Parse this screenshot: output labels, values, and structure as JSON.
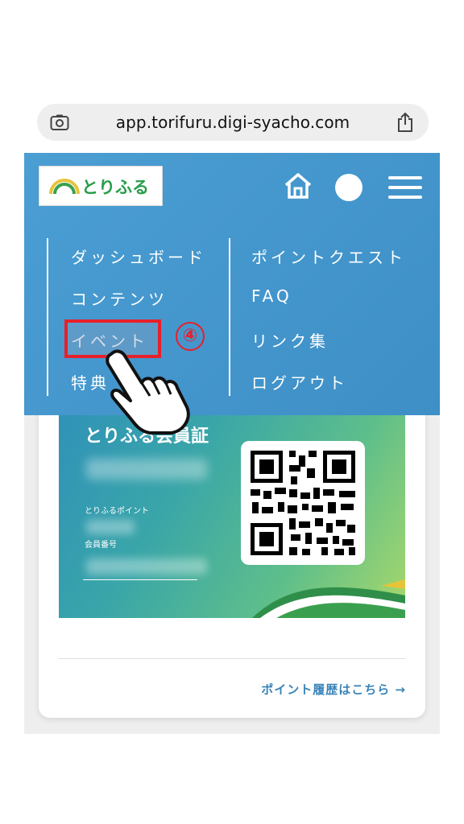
{
  "browser": {
    "url": "app.torifuru.digi-syacho.com"
  },
  "header": {
    "logo_text": "とりふる"
  },
  "menu": {
    "left_items": [
      {
        "label": "ダッシュボード"
      },
      {
        "label": "コンテンツ"
      },
      {
        "label": "イベント"
      },
      {
        "label": "特典"
      }
    ],
    "right_items": [
      {
        "label": "ポイントクエスト"
      },
      {
        "label": "FAQ"
      },
      {
        "label": "リンク集"
      },
      {
        "label": "ログアウト"
      }
    ],
    "step_marker": "④"
  },
  "member_card": {
    "title": "とりふる会員証",
    "points_label": "とりふるポイント",
    "member_no_label": "会員番号"
  },
  "footer": {
    "history_link": "ポイント履歴はこちら →"
  },
  "colors": {
    "menu_bg": "#4b9ed3",
    "highlight_border": "#e8202a",
    "link": "#3a84b8"
  }
}
